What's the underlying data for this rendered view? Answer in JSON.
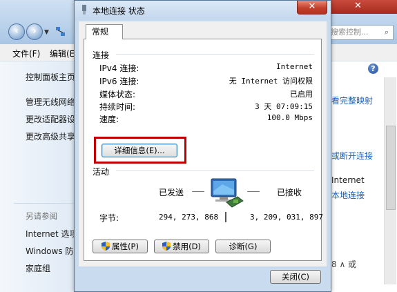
{
  "explorer": {
    "search_placeholder": "搜索控制...",
    "menu": [
      "文件(F)",
      "编辑(E"
    ],
    "left_links": [
      "控制面板主页",
      "管理无线网络",
      "更改适配器设",
      "更改高级共享"
    ],
    "see_also": "另请参阅",
    "see_also_links": [
      "Internet 选项",
      "Windows 防",
      "家庭组"
    ],
    "right_links": [
      "看完整映射",
      "或断开连接",
      "本地连接"
    ],
    "right_texts": [
      "Internet"
    ],
    "bottom_right": "8 ∧ 或"
  },
  "dialog": {
    "title": "本地连接 状态",
    "tab": "常规",
    "connection": {
      "label": "连接",
      "rows": [
        {
          "label": "IPv4 连接:",
          "value": "Internet"
        },
        {
          "label": "IPv6 连接:",
          "value": "无 Internet 访问权限"
        },
        {
          "label": "媒体状态:",
          "value": "已启用"
        },
        {
          "label": "持续时间:",
          "value": "3 天 07:09:15"
        },
        {
          "label": "速度:",
          "value": "100.0 Mbps"
        }
      ],
      "details_button": "详细信息(E)..."
    },
    "activity": {
      "label": "活动",
      "sent_label": "已发送",
      "received_label": "已接收",
      "bytes_label": "字节:",
      "bytes_sent": "294, 273, 868",
      "bytes_received": "3, 209, 031, 897"
    },
    "buttons": {
      "properties": "属性(P)",
      "disable": "禁用(D)",
      "diagnose": "诊断(G)",
      "close": "关闭(C)"
    }
  },
  "colors": {
    "highlight_border": "#c00000",
    "dialog_frame": "#c8dbef",
    "link": "#1c5db8"
  }
}
